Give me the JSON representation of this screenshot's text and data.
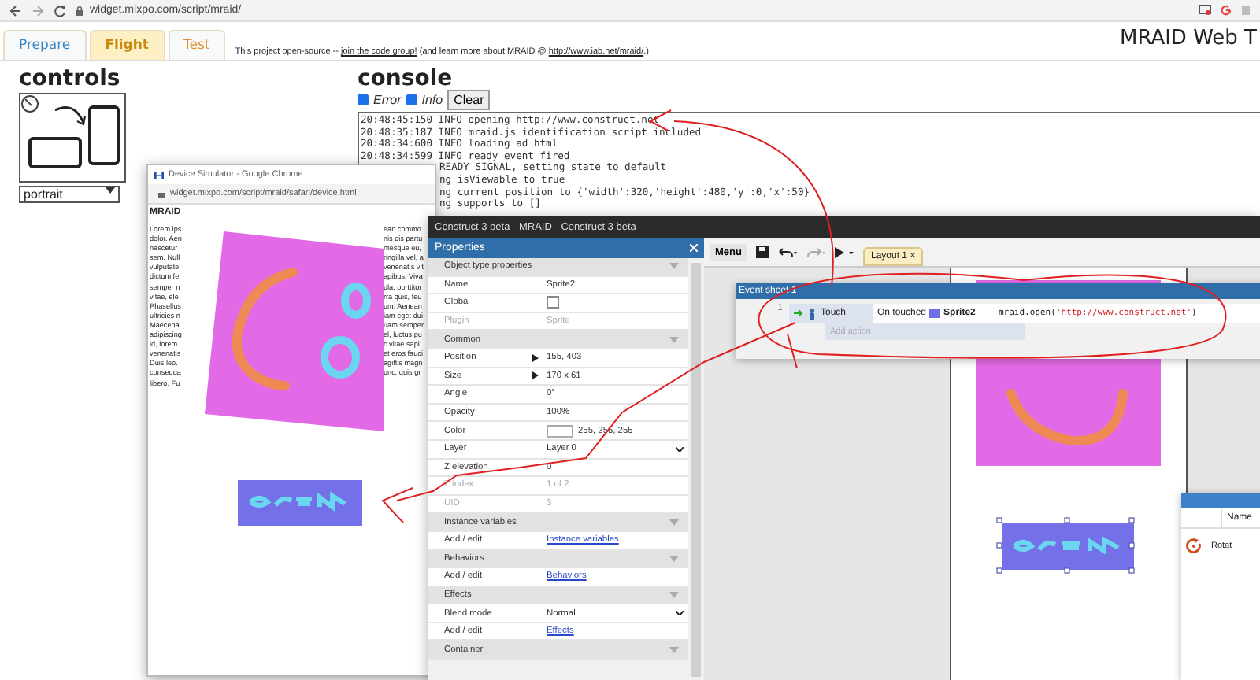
{
  "browser": {
    "url": "widget.mixpo.com/script/mraid/"
  },
  "site": {
    "tabs": [
      {
        "label": "Prepare",
        "selected": false,
        "color": "#3b86c4"
      },
      {
        "label": "Flight",
        "selected": true,
        "color": "#c98a12"
      },
      {
        "label": "Test",
        "selected": false,
        "color": "#e0902a"
      }
    ],
    "note": [
      {
        "kind": "text",
        "text": "This project open-source -- "
      },
      {
        "kind": "link",
        "text": "join the code group!"
      },
      {
        "kind": "text",
        "text": " (and learn more about MRAID @ "
      },
      {
        "kind": "link",
        "text": "http://www.iab.net/mraid/"
      },
      {
        "kind": "text",
        "text": ".)"
      }
    ],
    "title": "MRAID Web T"
  },
  "controls": {
    "heading": "controls",
    "orientation": "portrait"
  },
  "console": {
    "heading": "console",
    "filters": [
      {
        "label": "Error",
        "checked": true
      },
      {
        "label": "Info",
        "checked": true
      }
    ],
    "clear_button": "Clear",
    "lines": [
      {
        "kind": "full",
        "text": "20:48:45:150 INFO opening http://www.construct.net"
      },
      {
        "kind": "full",
        "text": "20:48:35:187 INFO mraid.js identification script included"
      },
      {
        "kind": "full",
        "text": "20:48:34:600 INFO loading ad html"
      },
      {
        "kind": "full",
        "text": "20:48:34:599 INFO ready event fired"
      },
      {
        "kind": "partial",
        "text": "READY SIGNAL, setting state to default"
      },
      {
        "kind": "partial",
        "text": "ng isViewable to true"
      },
      {
        "kind": "partial",
        "text": "ng current position to {'width':320,'height':480,'y':0,'x':50}"
      },
      {
        "kind": "partial",
        "text": "ng supports to []"
      }
    ]
  },
  "device_window": {
    "title": "Device Simulator - Google Chrome",
    "url": "widget.mixpo.com/script/mraid/safari/device.html",
    "heading": "MRAID",
    "left_fragments": [
      "Lorem ips",
      "dolor. Aen",
      "nascetur",
      "sem. Null",
      "vulputate",
      "dictum fe",
      "semper n",
      "vitae, ele",
      "Phasellus",
      "ultricies n",
      "Maecena",
      "adipiscing",
      "id, lorem.",
      "venenatis",
      "Duis leo.",
      "consequa",
      "libero. Fu"
    ],
    "right_fragments": [
      "ean commo",
      "nis dis partu",
      "ntesque eu,",
      "ringilla vel, a",
      "venenatis vit",
      "apibus. Viva",
      "ula, porttitor",
      "rra quis, feu",
      "um. Aenean",
      "iam eget dui",
      "uam semper",
      "el, luctus pu",
      "c vitae sapi",
      "et eros fauci",
      "agittis magn",
      "unc, quis gr"
    ]
  },
  "construct": {
    "title": "Construct 3 beta - MRAID - Construct 3 beta",
    "properties": {
      "title": "Properties",
      "sections": [
        {
          "title": "Object type properties",
          "rows": [
            {
              "name": "Name",
              "kind": "text",
              "value": "Sprite2",
              "disabled": false
            },
            {
              "name": "Global",
              "kind": "checkbox",
              "checked": false,
              "disabled": false
            },
            {
              "name": "Plugin",
              "kind": "text",
              "value": "Sprite",
              "disabled": true
            }
          ]
        },
        {
          "title": "Common",
          "rows": [
            {
              "name": "Position",
              "kind": "arrow",
              "value": "155, 403",
              "disabled": false
            },
            {
              "name": "Size",
              "kind": "arrow",
              "value": "170 x 61",
              "disabled": false
            },
            {
              "name": "Angle",
              "kind": "text",
              "value": "0°",
              "disabled": false
            },
            {
              "name": "Opacity",
              "kind": "text",
              "value": "100%",
              "disabled": false
            },
            {
              "name": "Color",
              "kind": "color",
              "value": "255, 255, 255",
              "disabled": false
            },
            {
              "name": "Layer",
              "kind": "dropdown",
              "value": "Layer 0",
              "disabled": false
            },
            {
              "name": "Z elevation",
              "kind": "text",
              "value": "0",
              "disabled": false
            },
            {
              "name": "Z index",
              "kind": "text",
              "value": "1 of 2",
              "disabled": true
            },
            {
              "name": "UID",
              "kind": "text",
              "value": "3",
              "disabled": true
            }
          ]
        },
        {
          "title": "Instance variables",
          "rows": [
            {
              "name": "Add / edit",
              "kind": "link",
              "value": "Instance variables",
              "disabled": false
            }
          ]
        },
        {
          "title": "Behaviors",
          "rows": [
            {
              "name": "Add / edit",
              "kind": "link",
              "value": "Behaviors",
              "disabled": false
            }
          ]
        },
        {
          "title": "Effects",
          "rows": [
            {
              "name": "Blend mode",
              "kind": "dropdown",
              "value": "Normal",
              "disabled": false
            },
            {
              "name": "Add / edit",
              "kind": "link",
              "value": "Effects",
              "disabled": false
            }
          ]
        },
        {
          "title": "Container"
        }
      ]
    },
    "toolbar": {
      "menu": "Menu",
      "tabs": [
        {
          "label": "Layout 1",
          "close": "×",
          "selected": true
        }
      ]
    },
    "event_sheet": {
      "title": "Event sheet 1",
      "events": [
        {
          "number": "1",
          "object": "Touch",
          "condition": "On touched",
          "target": "Sprite2",
          "action_prefix": "mraid.open(",
          "action_arg": "'http://www.construct.net'",
          "action_suffix": ")",
          "add_action": "Add action"
        }
      ]
    },
    "side_panel": {
      "column": "Name",
      "rows": [
        {
          "name": "Rotat"
        }
      ]
    }
  }
}
